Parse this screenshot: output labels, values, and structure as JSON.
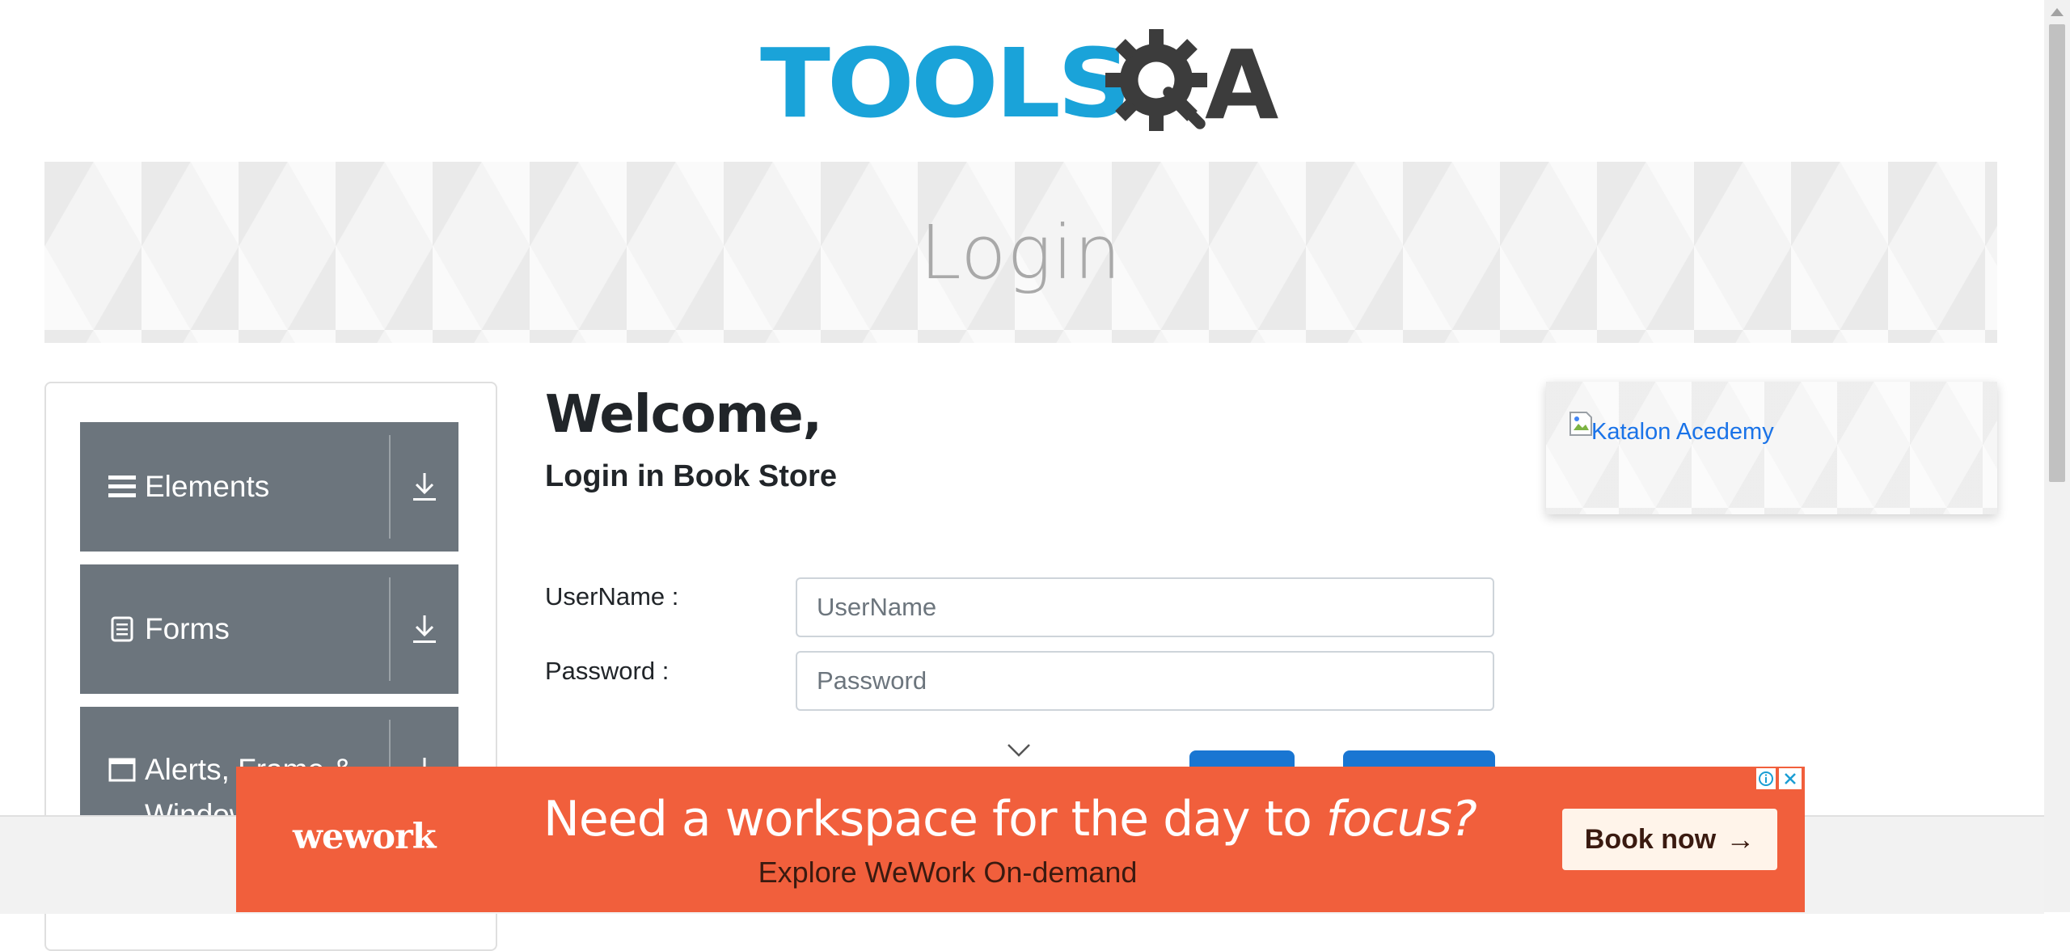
{
  "header": {
    "logo_tools": "TOOLS",
    "logo_q_a": "A"
  },
  "banner": {
    "title": "Login"
  },
  "sidebar": {
    "groups": [
      {
        "label": "Elements",
        "icon": "list-icon"
      },
      {
        "label": "Forms",
        "icon": "document-icon"
      },
      {
        "label": "Alerts, Frame & Windows",
        "icon": "window-icon"
      }
    ]
  },
  "main": {
    "welcome": "Welcome,",
    "subtitle": "Login in Book Store",
    "username_label": "UserName :",
    "username_placeholder": "UserName",
    "username_value": "",
    "password_label": "Password :",
    "password_placeholder": "Password",
    "password_value": ""
  },
  "side_ad": {
    "alt_text": "Katalon Acedemy"
  },
  "ad": {
    "brand": "wework",
    "headline_start": "Need a workspace for the day to ",
    "headline_emphasis": "focus?",
    "sub": "Explore WeWork On-demand",
    "cta": "Book now",
    "background_color": "#f15f3c"
  },
  "colors": {
    "brand_blue": "#1aa3d9",
    "sidebar_group": "#6c757d",
    "button_blue": "#1976d2"
  }
}
